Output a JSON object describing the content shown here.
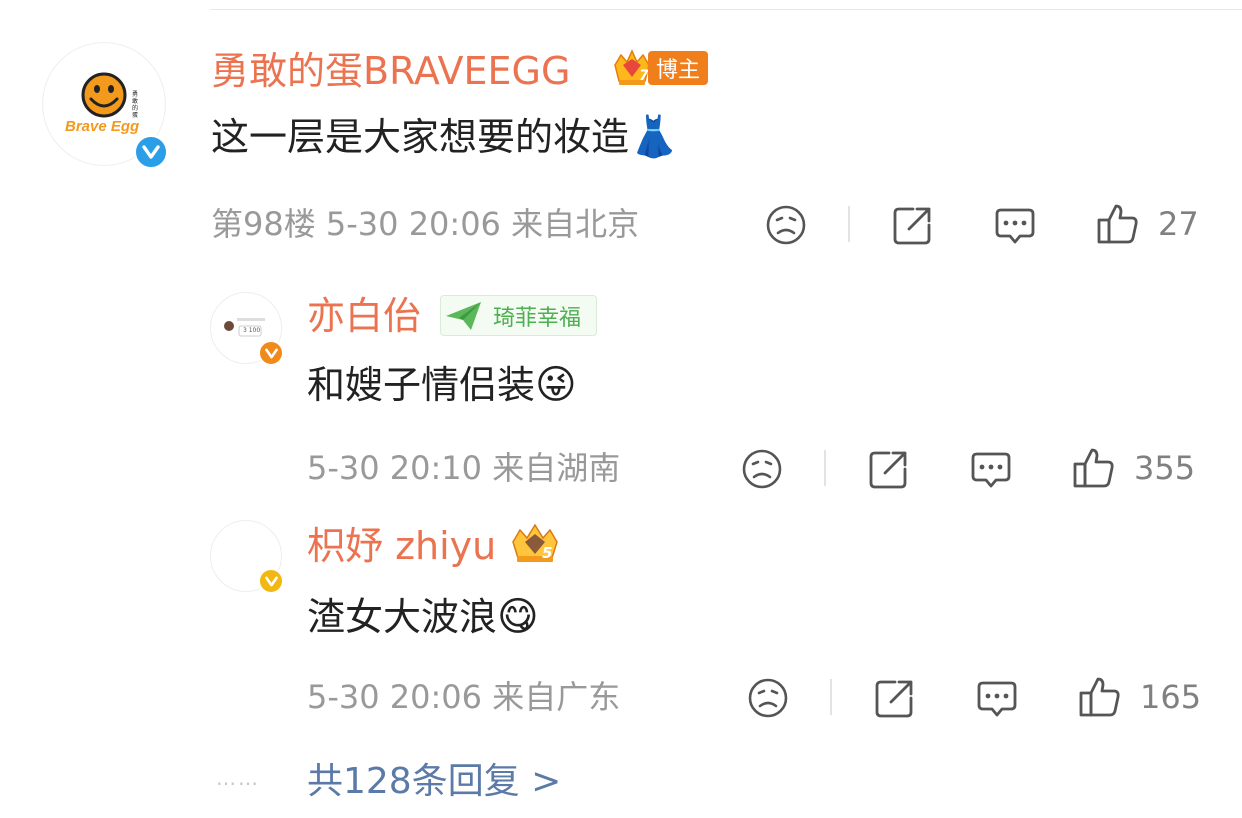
{
  "main_comment": {
    "avatar_text_top": "勇敢的蛋",
    "avatar_text_bottom": "Brave Egg",
    "username": "勇敢的蛋BRAVEEGG",
    "crown_level": "7",
    "badge_label": "博主",
    "text": "这一层是大家想要的妆造",
    "emoji": "👗",
    "meta": "第98楼 5-30 20:06 来自北京",
    "like_count": "27"
  },
  "replies": [
    {
      "username": "亦白佁",
      "badge_label": "琦菲幸福",
      "text": "和嫂子情侣装",
      "emoji": "😜",
      "meta": "5-30 20:10 来自湖南",
      "like_count": "355",
      "avatar_text": "3 100"
    },
    {
      "username": "枳妤 zhiyu",
      "crown_level": "5",
      "text": "渣女大波浪",
      "emoji": "😋",
      "meta": "5-30 20:06 来自广东",
      "like_count": "165"
    }
  ],
  "footer": {
    "dots": "……",
    "more_replies": "共128条回复 >"
  },
  "colors": {
    "username": "#eb7350",
    "meta": "#999999",
    "link": "#5b7aa8",
    "verified_blue": "#2b9ee8",
    "verified_orange": "#f08a19",
    "verified_yellow": "#f3b712",
    "tag_green": "#4caf50"
  }
}
